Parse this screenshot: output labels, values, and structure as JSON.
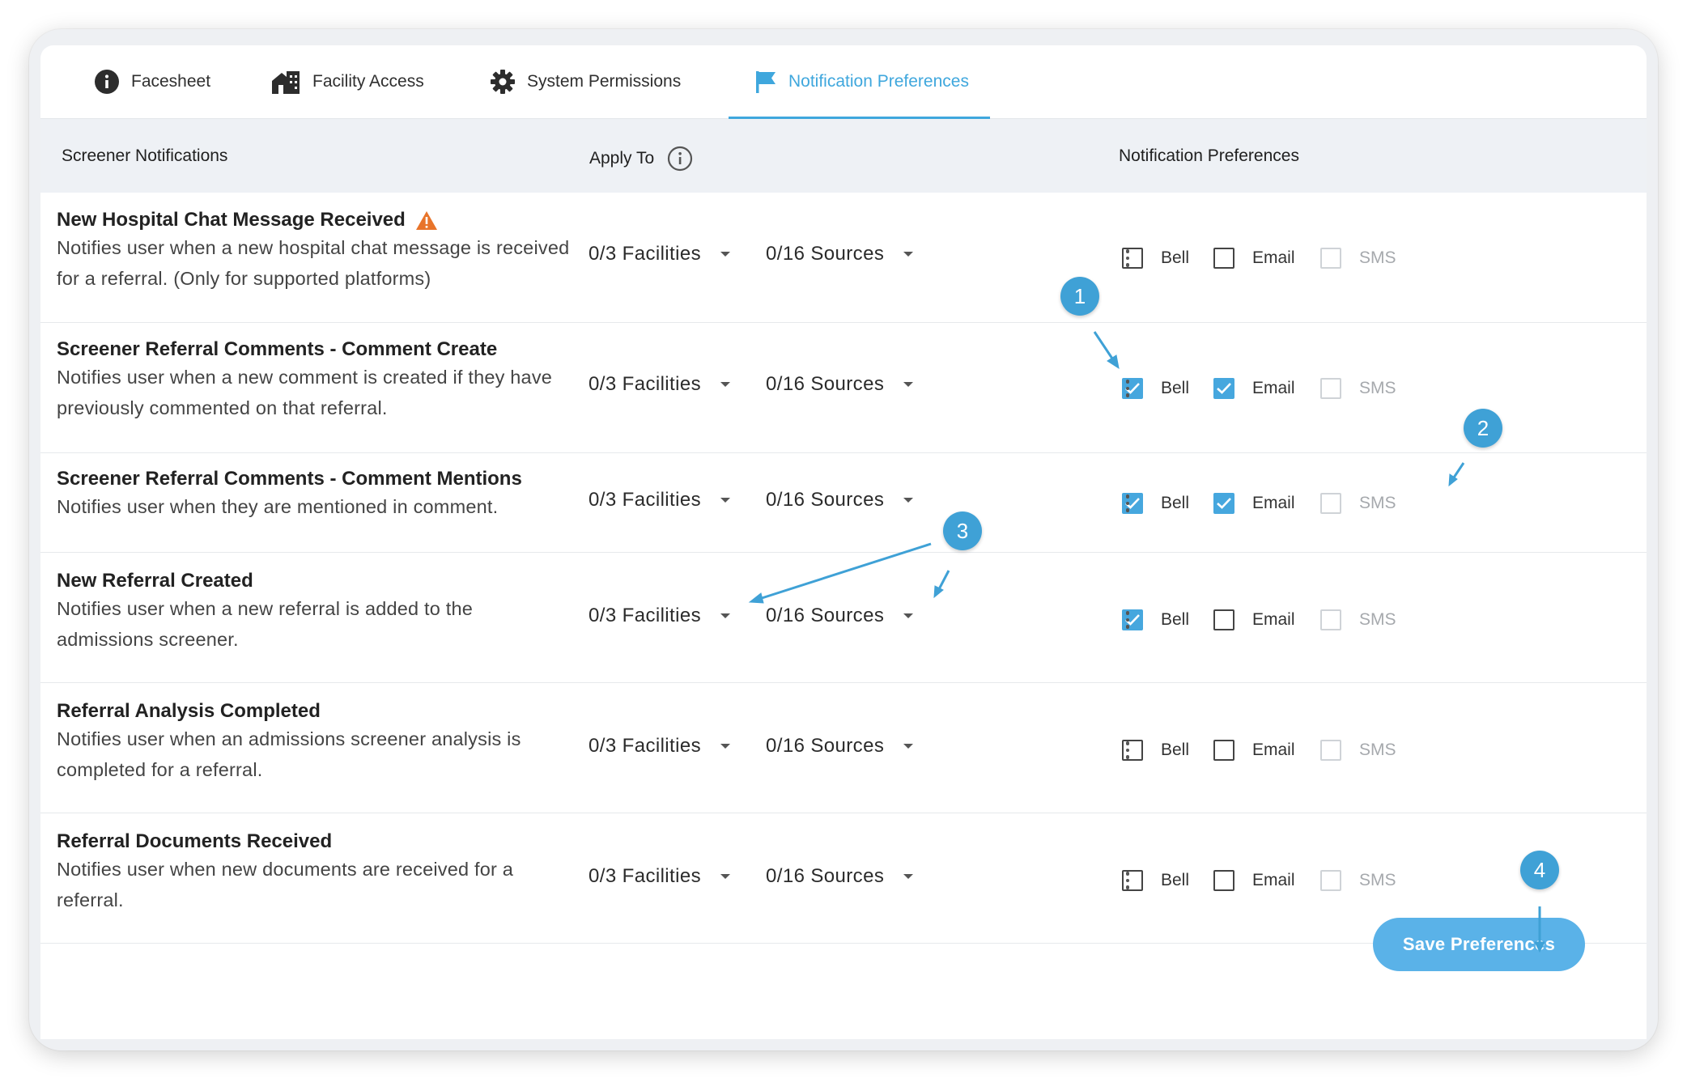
{
  "tabs": [
    {
      "label": "Facesheet",
      "icon": "info-icon"
    },
    {
      "label": "Facility Access",
      "icon": "building-icon"
    },
    {
      "label": "System Permissions",
      "icon": "gear-icon"
    },
    {
      "label": "Notification Preferences",
      "icon": "flag-icon",
      "active": true
    }
  ],
  "table_header": {
    "col_name": "Screener Notifications",
    "col_apply": "Apply To",
    "col_prefs": "Notification Preferences"
  },
  "rows": [
    {
      "title": "New Hospital Chat Message Received",
      "warning": true,
      "desc": "Notifies user when a new hospital chat message is received for a referral. (Only for supported platforms)",
      "facilities": "0/3 Facilities",
      "sources": "0/16 Sources",
      "bell": false,
      "email": false,
      "sms": false
    },
    {
      "title": "Screener Referral Comments - Comment Create",
      "desc": "Notifies user when a new comment is created if they have previously commented on that referral.",
      "facilities": "0/3 Facilities",
      "sources": "0/16 Sources",
      "bell": true,
      "email": true,
      "sms": false
    },
    {
      "title": "Screener Referral Comments - Comment Mentions",
      "desc": "Notifies user when they are mentioned in comment.",
      "facilities": "0/3 Facilities",
      "sources": "0/16 Sources",
      "bell": true,
      "email": true,
      "sms": false
    },
    {
      "title": "New Referral Created",
      "desc": "Notifies user when a new referral is added to the admissions screener.",
      "facilities": "0/3 Facilities",
      "sources": "0/16 Sources",
      "bell": true,
      "email": false,
      "sms": false
    },
    {
      "title": "Referral Analysis Completed",
      "desc": "Notifies user when an admissions screener analysis is completed for a referral.",
      "facilities": "0/3 Facilities",
      "sources": "0/16 Sources",
      "bell": false,
      "email": false,
      "sms": false
    },
    {
      "title": "Referral Documents Received",
      "desc": "Notifies user when new documents are received for a referral.",
      "facilities": "0/3 Facilities",
      "sources": "0/16 Sources",
      "bell": false,
      "email": false,
      "sms": false
    }
  ],
  "pref_labels": {
    "bell": "Bell",
    "email": "Email",
    "sms": "SMS"
  },
  "save_label": "Save Preferences",
  "callouts": [
    "1",
    "2",
    "3",
    "4"
  ],
  "colors": {
    "accent": "#3fa7dd",
    "checkbox_on": "#46a7de",
    "badge": "#3fa1d6",
    "warning": "#e8742a",
    "save_button": "#5ab2e8"
  }
}
